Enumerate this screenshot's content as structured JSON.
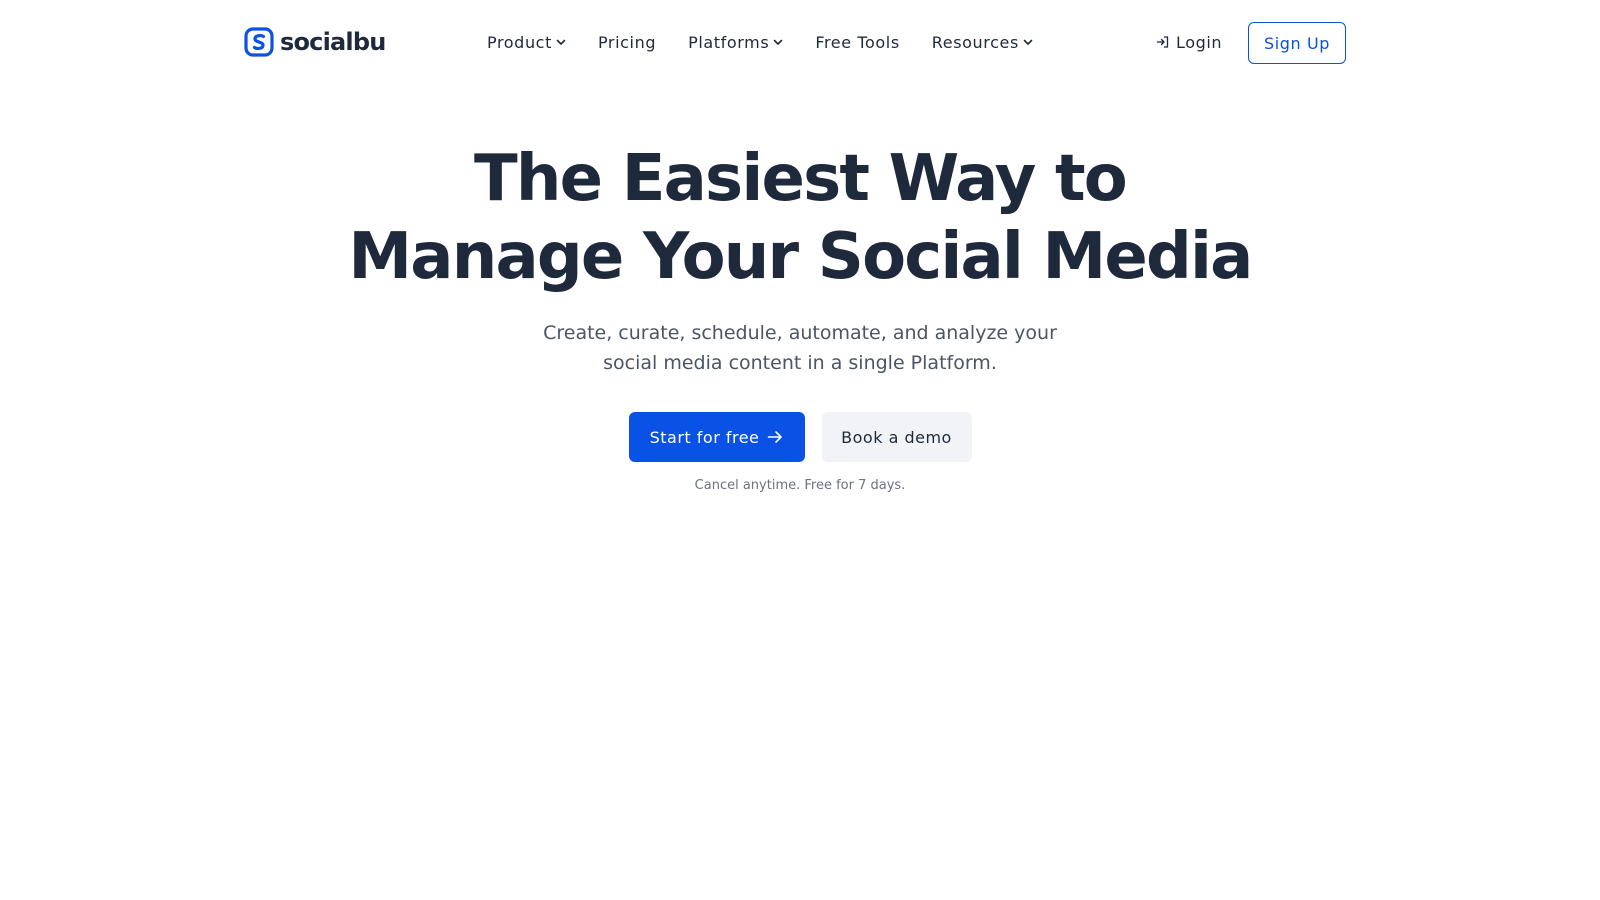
{
  "brand": {
    "name": "socialbu",
    "logo_icon": "socialbu-logo-icon",
    "primary_color": "#0a52e6",
    "text_color": "#1e293b"
  },
  "nav": {
    "items": [
      {
        "label": "Product",
        "has_dropdown": true
      },
      {
        "label": "Pricing",
        "has_dropdown": false
      },
      {
        "label": "Platforms",
        "has_dropdown": true
      },
      {
        "label": "Free Tools",
        "has_dropdown": false
      },
      {
        "label": "Resources",
        "has_dropdown": true
      }
    ],
    "login_label": "Login",
    "login_icon": "login-icon",
    "signup_label": "Sign Up"
  },
  "hero": {
    "title_line1": "The Easiest Way to",
    "title_line2": "Manage Your Social Media",
    "subtitle_line1": "Create, curate, schedule, automate, and analyze your",
    "subtitle_line2": "social media content in a single Platform.",
    "primary_cta": "Start for free",
    "primary_cta_icon": "arrow-right-icon",
    "secondary_cta": "Book a demo",
    "note": "Cancel anytime. Free for 7 days."
  }
}
